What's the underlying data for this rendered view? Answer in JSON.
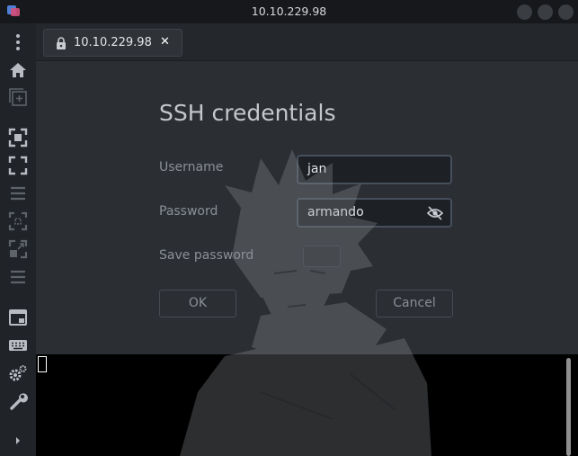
{
  "window": {
    "title": "10.10.229.98"
  },
  "tab": {
    "label": "10.10.229.98",
    "close_glyph": "✕"
  },
  "dialog": {
    "title": "SSH credentials",
    "username_label": "Username",
    "username_value": "jan",
    "password_label": "Password",
    "password_value": "armando",
    "save_password_label": "Save password",
    "ok_label": "OK",
    "cancel_label": "Cancel"
  },
  "sidebar": {
    "items": [
      "more-menu-icon",
      "home-icon",
      "new-tab-icon",
      "fit-screen-icon",
      "fullscreen-icon",
      "menu-icon",
      "scale-icon",
      "resize-icon",
      "list-icon",
      "window-icon",
      "keyboard-icon",
      "settings-icon",
      "tools-icon",
      "expand-icon"
    ]
  },
  "colors": {
    "accent_border": "#46505c",
    "terminal_bg": "#000000",
    "window_bg": "#2b2e33"
  }
}
